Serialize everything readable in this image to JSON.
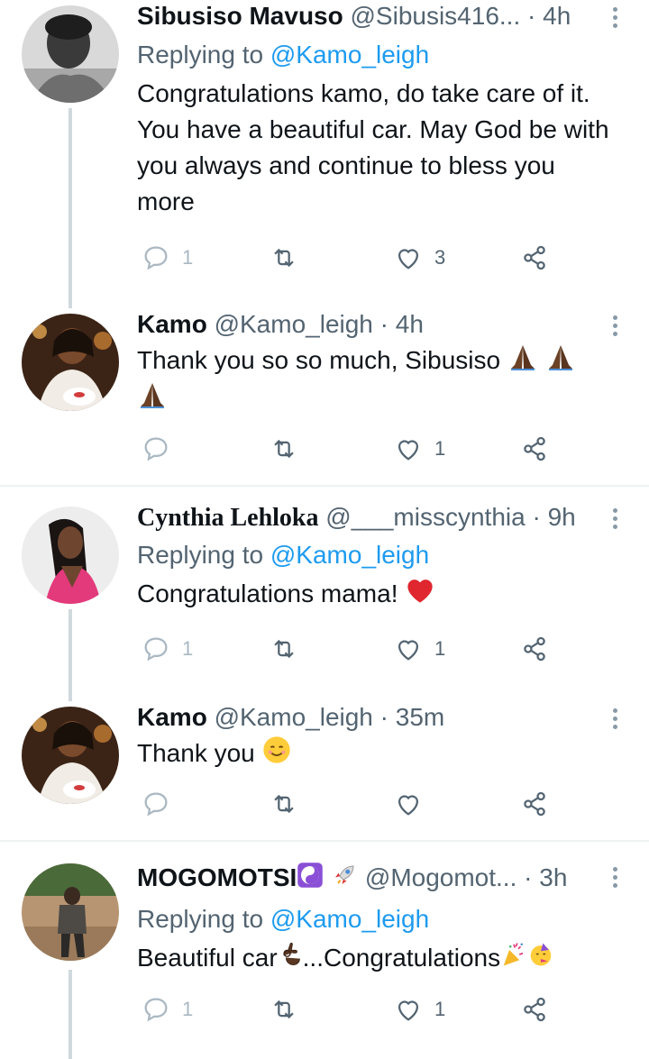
{
  "tweets": [
    {
      "name": "Sibusiso Mavuso",
      "handle": "@Sibusis416...",
      "time": "4h",
      "replying_label": "Replying to",
      "replying_to": "@Kamo_leigh",
      "text": "Congratulations kamo, do take care of it. You have a beautiful car. May God be with you always and continue to bless you more",
      "replies": "1",
      "likes": "3"
    },
    {
      "name": "Kamo",
      "handle": "@Kamo_leigh",
      "time": "4h",
      "text": "Thank you so so much, Sibusiso",
      "likes": "1"
    },
    {
      "name": "Cynthia Lehloka",
      "handle": "@___misscynthia",
      "time": "9h",
      "replying_label": "Replying to",
      "replying_to": "@Kamo_leigh",
      "text": "Congratulations mama!",
      "replies": "1",
      "likes": "1"
    },
    {
      "name": "Kamo",
      "handle": "@Kamo_leigh",
      "time": "35m",
      "text": "Thank you"
    },
    {
      "name": "MOGOMOTSI",
      "handle": "@Mogomot...",
      "time": "3h",
      "replying_label": "Replying to",
      "replying_to": "@Kamo_leigh",
      "text_a": "Beautiful car",
      "text_b": "...Congratulations",
      "replies": "1",
      "likes": "1"
    }
  ],
  "separator": "·",
  "icons": [
    "reply-icon",
    "retweet-icon",
    "like-icon",
    "share-icon",
    "more-icon"
  ],
  "colors": {
    "link": "#1d9bf0",
    "secondary": "#536471",
    "thread_line": "#cfd9de"
  }
}
